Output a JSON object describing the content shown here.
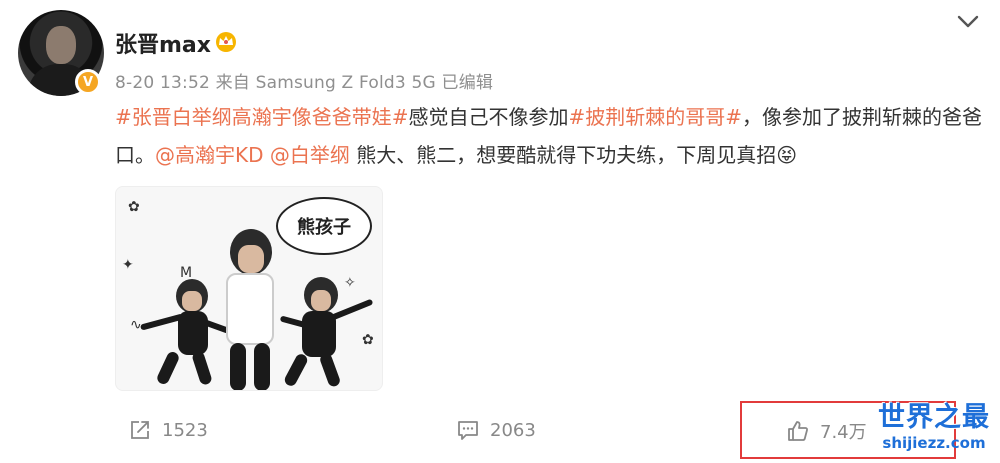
{
  "post": {
    "username": "张晋max",
    "meta": "8-20 13:52 来自 Samsung Z Fold3 5G 已编辑",
    "content": {
      "tag1": "#张晋白举纲高瀚宇像爸爸带娃#",
      "text1": "感觉自己不像参加",
      "tag2": "#披荆斩棘的哥哥#",
      "text2": "，像参加了披荆斩棘的爸爸口。",
      "mention1": "@高瀚宇KD",
      "mention2": "@白举纲",
      "text3": " 熊大、熊二，想要酷就得下功夫练，下周见真招😝"
    },
    "image_caption": "熊孩子"
  },
  "actions": {
    "repost_count": "1523",
    "comment_count": "2063",
    "like_count": "7.4万"
  },
  "icons": {
    "verified": "verified-badge-icon",
    "crown": "crown-icon",
    "menu": "chevron-down-icon",
    "repost": "share-icon",
    "comment": "comment-icon",
    "like": "thumbs-up-icon"
  },
  "colors": {
    "hashtag": "#eb7350",
    "verified": "#f5a623",
    "highlight_box": "#e23b3b",
    "watermark": "#1e6fd8"
  },
  "watermark": {
    "title": "世界之最",
    "url": "shijiezz.com"
  }
}
